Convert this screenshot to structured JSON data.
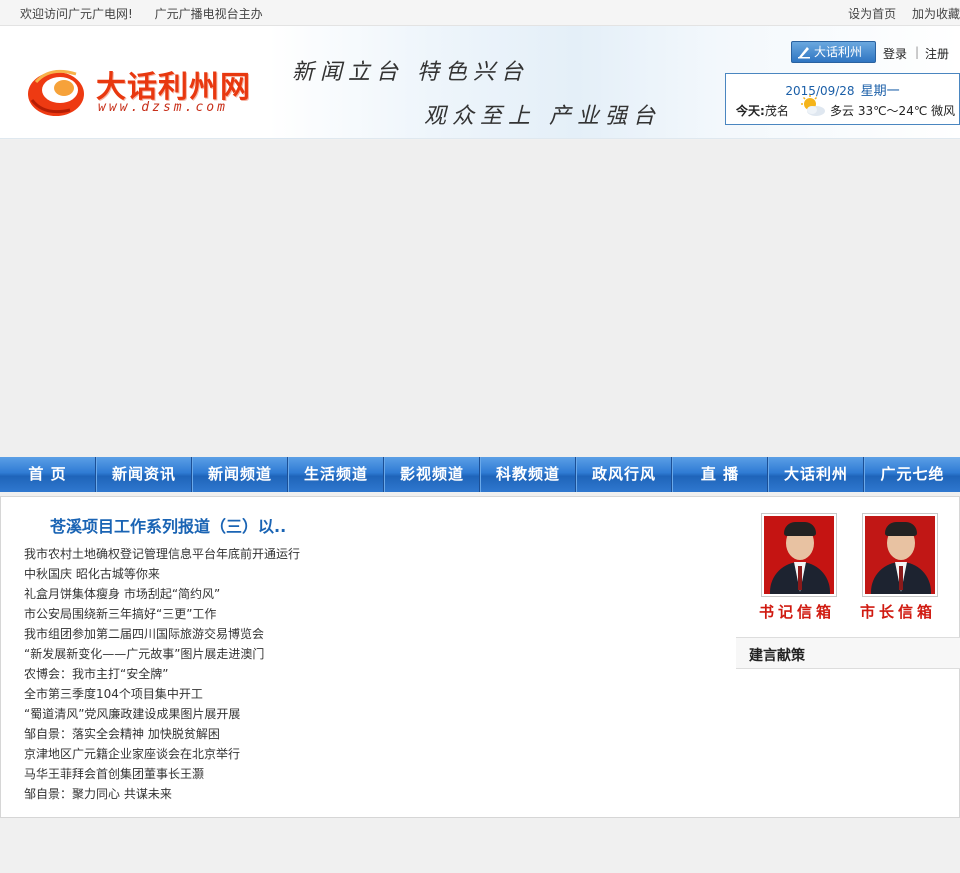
{
  "topbar": {
    "welcome": "欢迎访问广元广电网!",
    "host": "广元广播电视台主办",
    "set_home": "设为首页",
    "favorite": "加为收藏"
  },
  "header": {
    "logo_title": "大话利州网",
    "logo_url": "www.dzsm.com",
    "slogan_line1": "新闻立台  特色兴台",
    "slogan_line2": "观众至上  产业强台",
    "member_button": "大话利州",
    "login": "登录",
    "separator": "|",
    "register": "注册"
  },
  "weather": {
    "date": "2015/09/28",
    "weekday": "星期一",
    "today_label": "今天:",
    "city": "茂名",
    "condition": "多云 33℃～24℃ 微风"
  },
  "nav": {
    "items": [
      "首  页",
      "新闻资讯",
      "新闻频道",
      "生活频道",
      "影视频道",
      "科教频道",
      "政风行风",
      "直  播",
      "大话利州",
      "广元七绝"
    ]
  },
  "main": {
    "headline": "苍溪项目工作系列报道（三）以..",
    "news": [
      "我市农村土地确权登记管理信息平台年底前开通运行",
      "中秋国庆 昭化古城等你来",
      "礼盒月饼集体瘦身 市场刮起“简约风”",
      "市公安局围绕新三年搞好“三更”工作",
      "我市组团参加第二届四川国际旅游交易博览会",
      "“新发展新变化——广元故事”图片展走进澳门",
      "农博会：我市主打“安全牌”",
      "全市第三季度104个项目集中开工",
      "“蜀道清风”党风廉政建设成果图片展开展",
      "邹自景：落实全会精神 加快脱贫解困",
      "京津地区广元籍企业家座谈会在北京举行",
      "马华王菲拜会首创集团董事长王灏",
      "邹自景：聚力同心 共谋未来"
    ],
    "mailbox_secretary": "书记信箱",
    "mailbox_mayor": "市长信箱",
    "suggest_title": "建言献策"
  }
}
